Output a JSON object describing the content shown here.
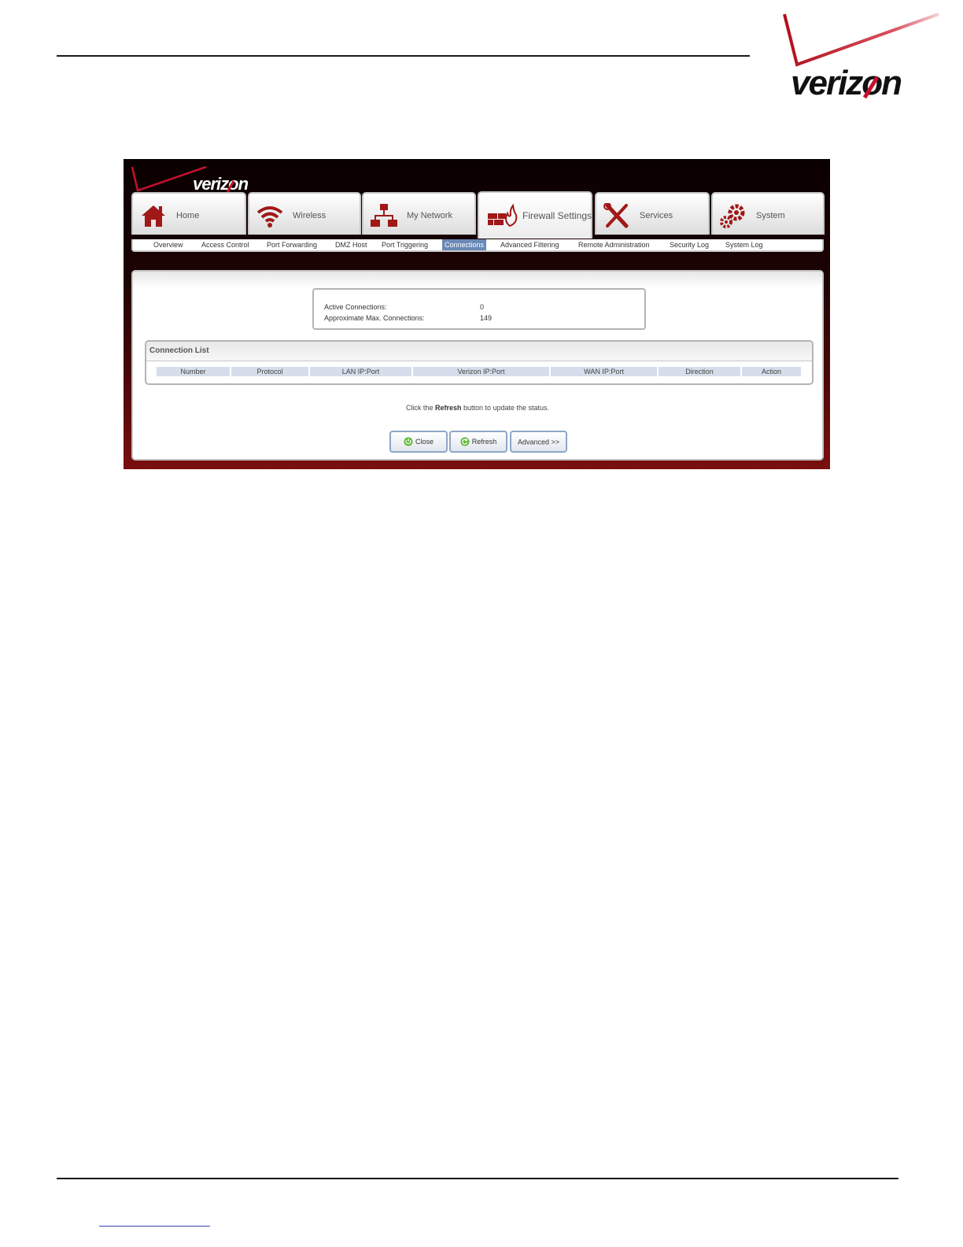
{
  "brand": {
    "name": "verizon",
    "accent": "#c8102e"
  },
  "tabs": [
    {
      "label": "Home",
      "icon": "home-icon"
    },
    {
      "label": "Wireless",
      "icon": "wireless-icon"
    },
    {
      "label": "My Network",
      "icon": "network-icon"
    },
    {
      "label": "Firewall Settings",
      "icon": "firewall-icon",
      "active": true
    },
    {
      "label": "Services",
      "icon": "tools-icon"
    },
    {
      "label": "System",
      "icon": "gears-icon"
    }
  ],
  "subnav": [
    {
      "label": "Overview"
    },
    {
      "label": "Access Control"
    },
    {
      "label": "Port Forwarding"
    },
    {
      "label": "DMZ Host"
    },
    {
      "label": "Port Triggering"
    },
    {
      "label": "Connections",
      "active": true
    },
    {
      "label": "Advanced Filtering"
    },
    {
      "label": "Remote Administration"
    },
    {
      "label": "Security Log"
    },
    {
      "label": "System Log"
    }
  ],
  "stats": {
    "active_label": "Active Connections:",
    "active_value": "0",
    "max_label": "Approximate Max. Connections:",
    "max_value": "149"
  },
  "connection_list": {
    "title": "Connection List",
    "columns": [
      "Number",
      "Protocol",
      "LAN IP:Port",
      "Verizon IP:Port",
      "WAN IP:Port",
      "Direction",
      "Action"
    ]
  },
  "hint": {
    "prefix": "Click the ",
    "bold": "Refresh",
    "suffix": " button to update the status."
  },
  "buttons": {
    "close": "Close",
    "refresh": "Refresh",
    "advanced": "Advanced >>"
  }
}
